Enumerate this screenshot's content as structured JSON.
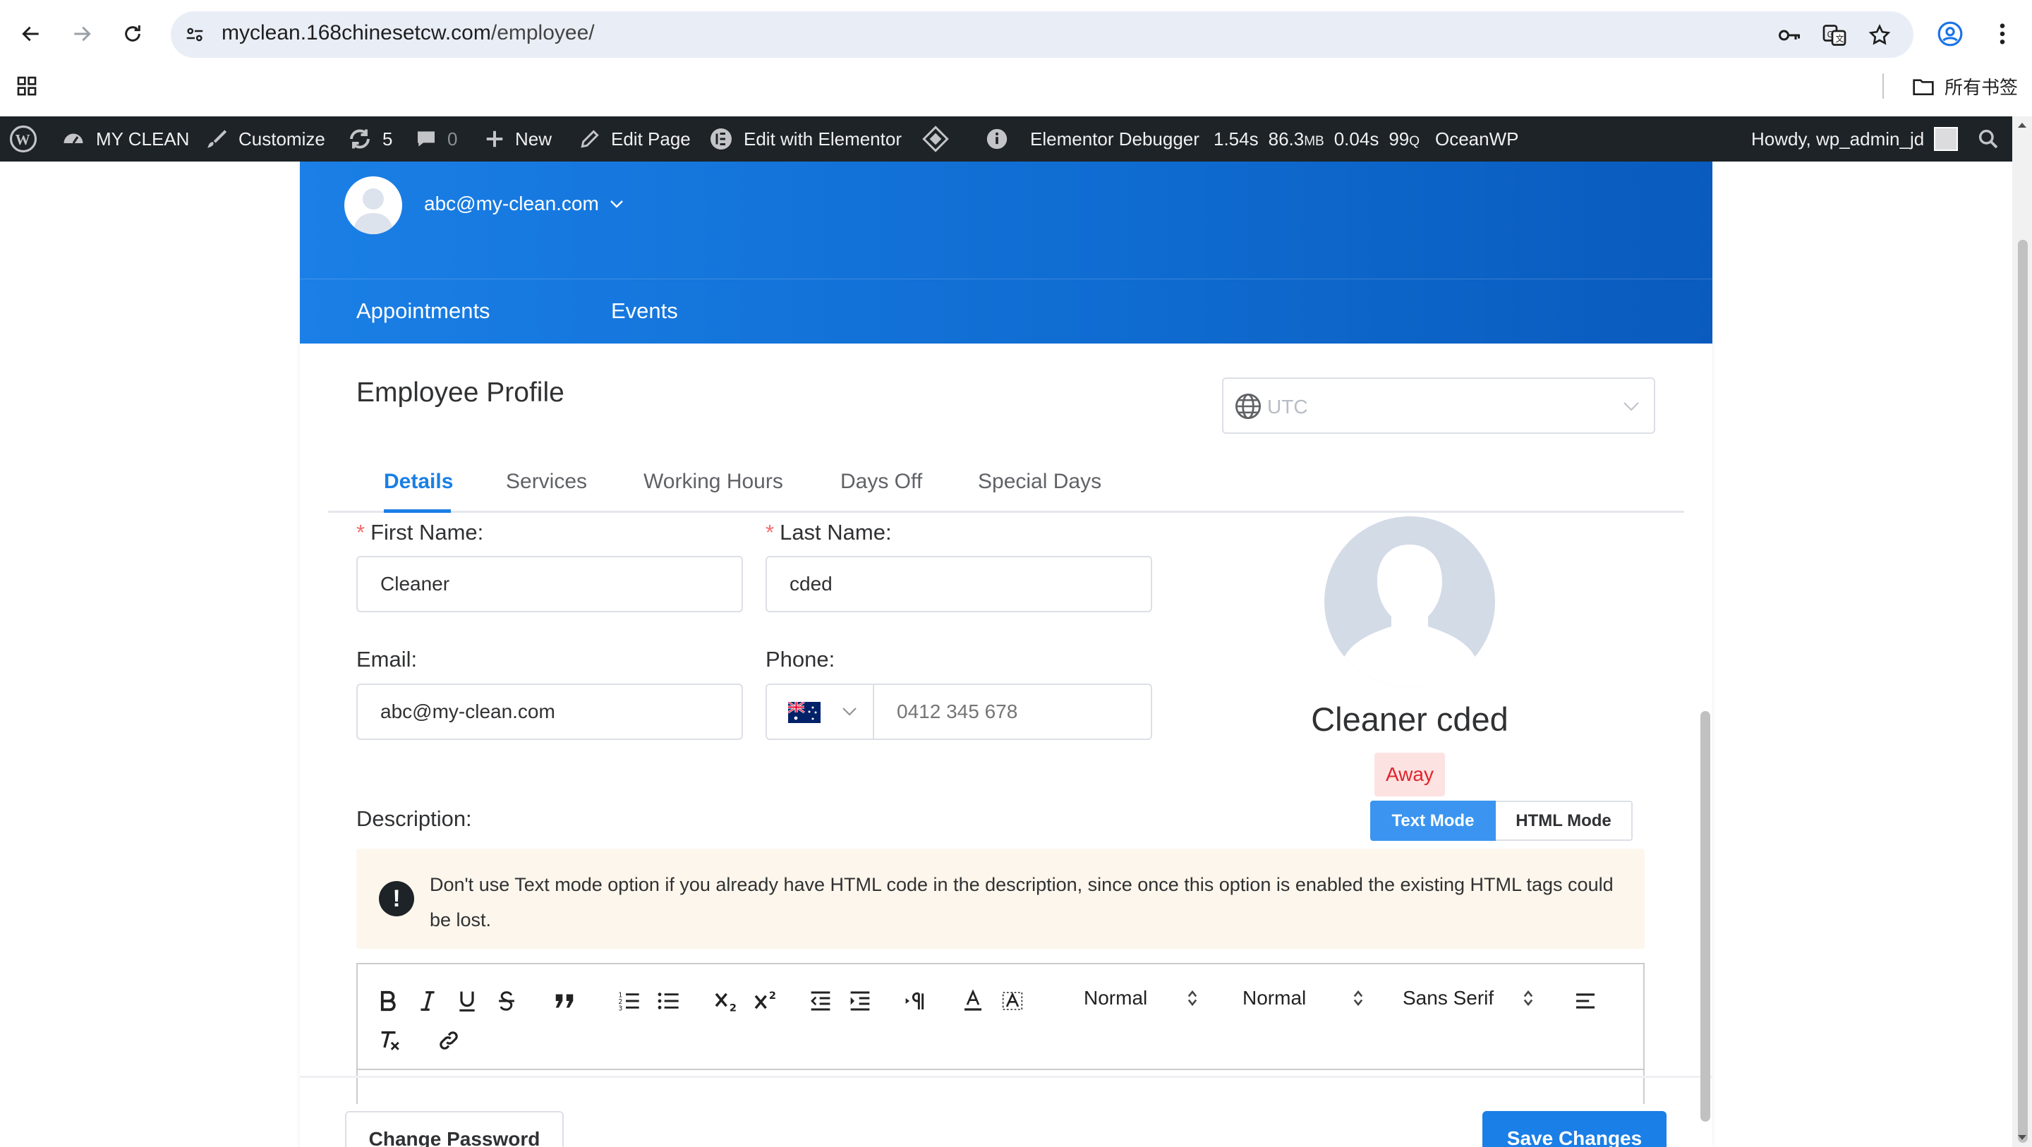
{
  "browser": {
    "url_host": "myclean.168chinesetcw.com",
    "url_path": "/employee/",
    "bookmarks_label": "所有书签"
  },
  "admin_bar": {
    "site_name": "MY CLEAN",
    "customize": "Customize",
    "updates_count": "5",
    "comments_count": "0",
    "new": "New",
    "edit_page": "Edit Page",
    "edit_with_elementor": "Edit with Elementor",
    "elementor_debugger": "Elementor Debugger",
    "perf_time": "1.54s",
    "perf_mem": "86.3",
    "perf_mem_unit": "MB",
    "perf_query_time": "0.04s",
    "perf_queries": "99",
    "perf_queries_unit": "Q",
    "theme": "OceanWP",
    "howdy": "Howdy, wp_admin_jd"
  },
  "banner": {
    "user_email": "abc@my-clean.com",
    "tabs": [
      "Appointments",
      "Events"
    ]
  },
  "profile": {
    "title": "Employee Profile",
    "timezone_value": "UTC",
    "tabs": [
      "Details",
      "Services",
      "Working Hours",
      "Days Off",
      "Special Days"
    ],
    "active_tab": "Details",
    "first_name_label": "First Name:",
    "first_name_value": "Cleaner",
    "last_name_label": "Last Name:",
    "last_name_value": "cded",
    "email_label": "Email:",
    "email_value": "abc@my-clean.com",
    "phone_label": "Phone:",
    "phone_placeholder": "0412 345 678",
    "full_name": "Cleaner cded",
    "status": "Away",
    "description_label": "Description:",
    "mode_text": "Text Mode",
    "mode_html": "HTML Mode",
    "notice": "Don't use Text mode option if you already have HTML code in the description, since once this option is enabled the existing HTML tags could be lost."
  },
  "editor_toolbar": {
    "header_select": "Normal",
    "size_select": "Normal",
    "font_select": "Sans Serif"
  },
  "footer": {
    "change_password": "Change Password",
    "save_changes": "Save Changes"
  },
  "colors": {
    "primary": "#1a7fe6",
    "admin_bar": "#1d2327",
    "status_away_bg": "#fde2e2",
    "status_away_text": "#e0242a",
    "notice_bg": "#fdf6ec"
  }
}
